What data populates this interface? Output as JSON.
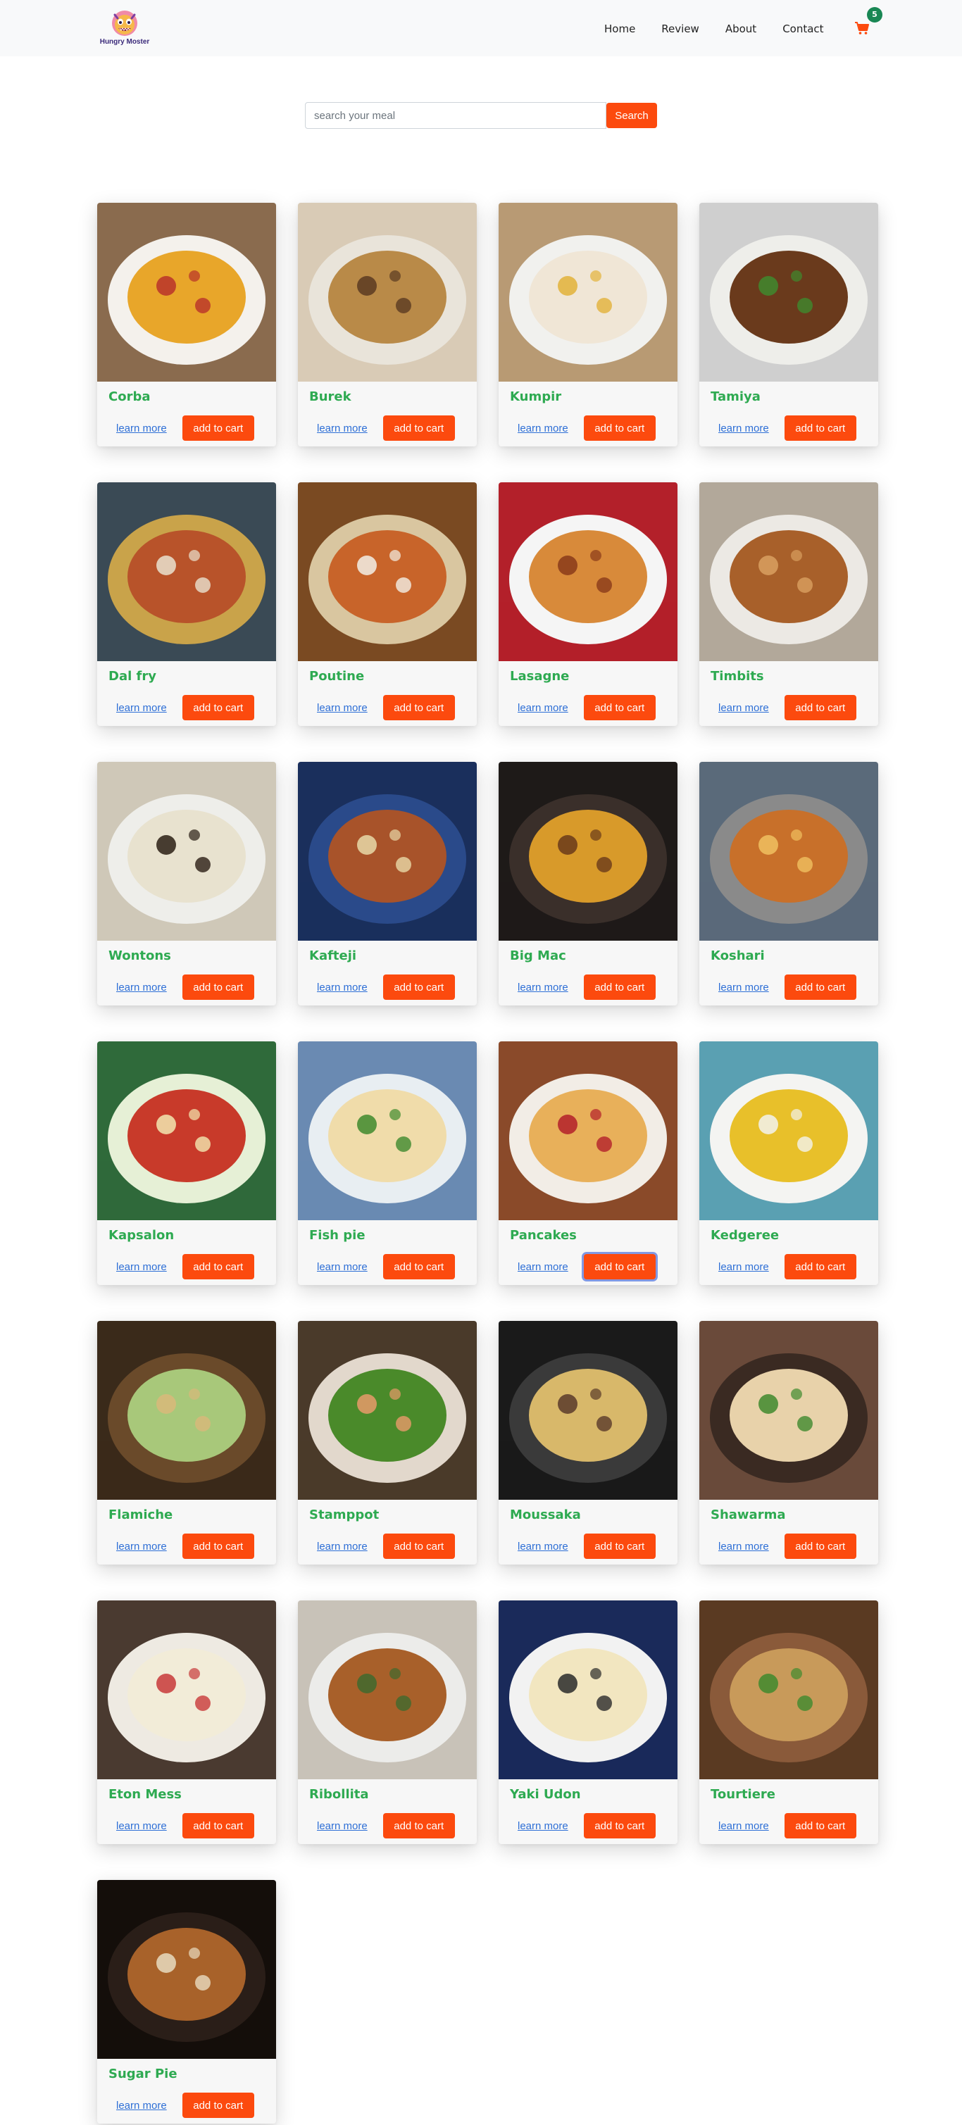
{
  "brand": {
    "name": "Hungry Moster",
    "logo_icon": "monster-face-icon"
  },
  "nav": {
    "links": [
      "Home",
      "Review",
      "About",
      "Contact"
    ],
    "cart_icon": "shopping-cart-icon",
    "cart_count": "5"
  },
  "search": {
    "placeholder": "search your meal",
    "value": "",
    "button_label": "Search"
  },
  "colors": {
    "accent": "#fc4a0e",
    "title_green": "#2eaa51",
    "badge_green": "#198754",
    "link_blue": "#2e6fd6"
  },
  "meals": [
    {
      "name": "Corba",
      "learn_more": "learn more",
      "add_to_cart": "add to cart"
    },
    {
      "name": "Burek",
      "learn_more": "learn more",
      "add_to_cart": "add to cart"
    },
    {
      "name": "Kumpir",
      "learn_more": "learn more",
      "add_to_cart": "add to cart"
    },
    {
      "name": "Tamiya",
      "learn_more": "learn more",
      "add_to_cart": "add to cart"
    },
    {
      "name": "Dal fry",
      "learn_more": "learn more",
      "add_to_cart": "add to cart"
    },
    {
      "name": "Poutine",
      "learn_more": "learn more",
      "add_to_cart": "add to cart"
    },
    {
      "name": "Lasagne",
      "learn_more": "learn more",
      "add_to_cart": "add to cart"
    },
    {
      "name": "Timbits",
      "learn_more": "learn more",
      "add_to_cart": "add to cart"
    },
    {
      "name": "Wontons",
      "learn_more": "learn more",
      "add_to_cart": "add to cart"
    },
    {
      "name": "Kafteji",
      "learn_more": "learn more",
      "add_to_cart": "add to cart"
    },
    {
      "name": "Big Mac",
      "learn_more": "learn more",
      "add_to_cart": "add to cart"
    },
    {
      "name": "Koshari",
      "learn_more": "learn more",
      "add_to_cart": "add to cart"
    },
    {
      "name": "Kapsalon",
      "learn_more": "learn more",
      "add_to_cart": "add to cart"
    },
    {
      "name": "Fish pie",
      "learn_more": "learn more",
      "add_to_cart": "add to cart"
    },
    {
      "name": "Pancakes",
      "learn_more": "learn more",
      "add_to_cart": "add to cart",
      "focused": true
    },
    {
      "name": "Kedgeree",
      "learn_more": "learn more",
      "add_to_cart": "add to cart"
    },
    {
      "name": "Flamiche",
      "learn_more": "learn more",
      "add_to_cart": "add to cart"
    },
    {
      "name": "Stamppot",
      "learn_more": "learn more",
      "add_to_cart": "add to cart"
    },
    {
      "name": "Moussaka",
      "learn_more": "learn more",
      "add_to_cart": "add to cart"
    },
    {
      "name": "Shawarma",
      "learn_more": "learn more",
      "add_to_cart": "add to cart"
    },
    {
      "name": "Eton Mess",
      "learn_more": "learn more",
      "add_to_cart": "add to cart"
    },
    {
      "name": "Ribollita",
      "learn_more": "learn more",
      "add_to_cart": "add to cart"
    },
    {
      "name": "Yaki Udon",
      "learn_more": "learn more",
      "add_to_cart": "add to cart"
    },
    {
      "name": "Tourtiere",
      "learn_more": "learn more",
      "add_to_cart": "add to cart"
    },
    {
      "name": "Sugar Pie",
      "learn_more": "learn more",
      "add_to_cart": "add to cart"
    }
  ]
}
